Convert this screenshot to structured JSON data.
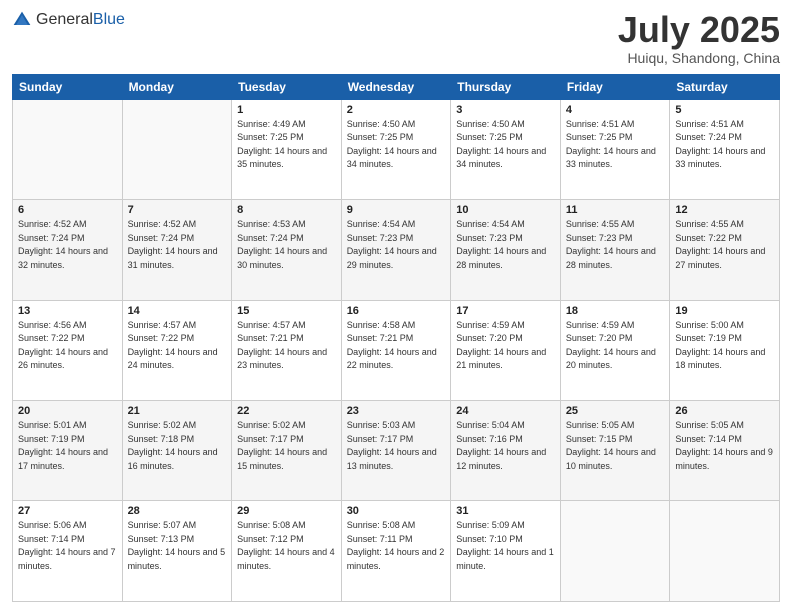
{
  "header": {
    "logo": {
      "general": "General",
      "blue": "Blue"
    },
    "title": "July 2025",
    "location": "Huiqu, Shandong, China"
  },
  "weekdays": [
    "Sunday",
    "Monday",
    "Tuesday",
    "Wednesday",
    "Thursday",
    "Friday",
    "Saturday"
  ],
  "weeks": [
    [
      {
        "day": "",
        "sunrise": "",
        "sunset": "",
        "daylight": ""
      },
      {
        "day": "",
        "sunrise": "",
        "sunset": "",
        "daylight": ""
      },
      {
        "day": "1",
        "sunrise": "Sunrise: 4:49 AM",
        "sunset": "Sunset: 7:25 PM",
        "daylight": "Daylight: 14 hours and 35 minutes."
      },
      {
        "day": "2",
        "sunrise": "Sunrise: 4:50 AM",
        "sunset": "Sunset: 7:25 PM",
        "daylight": "Daylight: 14 hours and 34 minutes."
      },
      {
        "day": "3",
        "sunrise": "Sunrise: 4:50 AM",
        "sunset": "Sunset: 7:25 PM",
        "daylight": "Daylight: 14 hours and 34 minutes."
      },
      {
        "day": "4",
        "sunrise": "Sunrise: 4:51 AM",
        "sunset": "Sunset: 7:25 PM",
        "daylight": "Daylight: 14 hours and 33 minutes."
      },
      {
        "day": "5",
        "sunrise": "Sunrise: 4:51 AM",
        "sunset": "Sunset: 7:24 PM",
        "daylight": "Daylight: 14 hours and 33 minutes."
      }
    ],
    [
      {
        "day": "6",
        "sunrise": "Sunrise: 4:52 AM",
        "sunset": "Sunset: 7:24 PM",
        "daylight": "Daylight: 14 hours and 32 minutes."
      },
      {
        "day": "7",
        "sunrise": "Sunrise: 4:52 AM",
        "sunset": "Sunset: 7:24 PM",
        "daylight": "Daylight: 14 hours and 31 minutes."
      },
      {
        "day": "8",
        "sunrise": "Sunrise: 4:53 AM",
        "sunset": "Sunset: 7:24 PM",
        "daylight": "Daylight: 14 hours and 30 minutes."
      },
      {
        "day": "9",
        "sunrise": "Sunrise: 4:54 AM",
        "sunset": "Sunset: 7:23 PM",
        "daylight": "Daylight: 14 hours and 29 minutes."
      },
      {
        "day": "10",
        "sunrise": "Sunrise: 4:54 AM",
        "sunset": "Sunset: 7:23 PM",
        "daylight": "Daylight: 14 hours and 28 minutes."
      },
      {
        "day": "11",
        "sunrise": "Sunrise: 4:55 AM",
        "sunset": "Sunset: 7:23 PM",
        "daylight": "Daylight: 14 hours and 28 minutes."
      },
      {
        "day": "12",
        "sunrise": "Sunrise: 4:55 AM",
        "sunset": "Sunset: 7:22 PM",
        "daylight": "Daylight: 14 hours and 27 minutes."
      }
    ],
    [
      {
        "day": "13",
        "sunrise": "Sunrise: 4:56 AM",
        "sunset": "Sunset: 7:22 PM",
        "daylight": "Daylight: 14 hours and 26 minutes."
      },
      {
        "day": "14",
        "sunrise": "Sunrise: 4:57 AM",
        "sunset": "Sunset: 7:22 PM",
        "daylight": "Daylight: 14 hours and 24 minutes."
      },
      {
        "day": "15",
        "sunrise": "Sunrise: 4:57 AM",
        "sunset": "Sunset: 7:21 PM",
        "daylight": "Daylight: 14 hours and 23 minutes."
      },
      {
        "day": "16",
        "sunrise": "Sunrise: 4:58 AM",
        "sunset": "Sunset: 7:21 PM",
        "daylight": "Daylight: 14 hours and 22 minutes."
      },
      {
        "day": "17",
        "sunrise": "Sunrise: 4:59 AM",
        "sunset": "Sunset: 7:20 PM",
        "daylight": "Daylight: 14 hours and 21 minutes."
      },
      {
        "day": "18",
        "sunrise": "Sunrise: 4:59 AM",
        "sunset": "Sunset: 7:20 PM",
        "daylight": "Daylight: 14 hours and 20 minutes."
      },
      {
        "day": "19",
        "sunrise": "Sunrise: 5:00 AM",
        "sunset": "Sunset: 7:19 PM",
        "daylight": "Daylight: 14 hours and 18 minutes."
      }
    ],
    [
      {
        "day": "20",
        "sunrise": "Sunrise: 5:01 AM",
        "sunset": "Sunset: 7:19 PM",
        "daylight": "Daylight: 14 hours and 17 minutes."
      },
      {
        "day": "21",
        "sunrise": "Sunrise: 5:02 AM",
        "sunset": "Sunset: 7:18 PM",
        "daylight": "Daylight: 14 hours and 16 minutes."
      },
      {
        "day": "22",
        "sunrise": "Sunrise: 5:02 AM",
        "sunset": "Sunset: 7:17 PM",
        "daylight": "Daylight: 14 hours and 15 minutes."
      },
      {
        "day": "23",
        "sunrise": "Sunrise: 5:03 AM",
        "sunset": "Sunset: 7:17 PM",
        "daylight": "Daylight: 14 hours and 13 minutes."
      },
      {
        "day": "24",
        "sunrise": "Sunrise: 5:04 AM",
        "sunset": "Sunset: 7:16 PM",
        "daylight": "Daylight: 14 hours and 12 minutes."
      },
      {
        "day": "25",
        "sunrise": "Sunrise: 5:05 AM",
        "sunset": "Sunset: 7:15 PM",
        "daylight": "Daylight: 14 hours and 10 minutes."
      },
      {
        "day": "26",
        "sunrise": "Sunrise: 5:05 AM",
        "sunset": "Sunset: 7:14 PM",
        "daylight": "Daylight: 14 hours and 9 minutes."
      }
    ],
    [
      {
        "day": "27",
        "sunrise": "Sunrise: 5:06 AM",
        "sunset": "Sunset: 7:14 PM",
        "daylight": "Daylight: 14 hours and 7 minutes."
      },
      {
        "day": "28",
        "sunrise": "Sunrise: 5:07 AM",
        "sunset": "Sunset: 7:13 PM",
        "daylight": "Daylight: 14 hours and 5 minutes."
      },
      {
        "day": "29",
        "sunrise": "Sunrise: 5:08 AM",
        "sunset": "Sunset: 7:12 PM",
        "daylight": "Daylight: 14 hours and 4 minutes."
      },
      {
        "day": "30",
        "sunrise": "Sunrise: 5:08 AM",
        "sunset": "Sunset: 7:11 PM",
        "daylight": "Daylight: 14 hours and 2 minutes."
      },
      {
        "day": "31",
        "sunrise": "Sunrise: 5:09 AM",
        "sunset": "Sunset: 7:10 PM",
        "daylight": "Daylight: 14 hours and 1 minute."
      },
      {
        "day": "",
        "sunrise": "",
        "sunset": "",
        "daylight": ""
      },
      {
        "day": "",
        "sunrise": "",
        "sunset": "",
        "daylight": ""
      }
    ]
  ]
}
